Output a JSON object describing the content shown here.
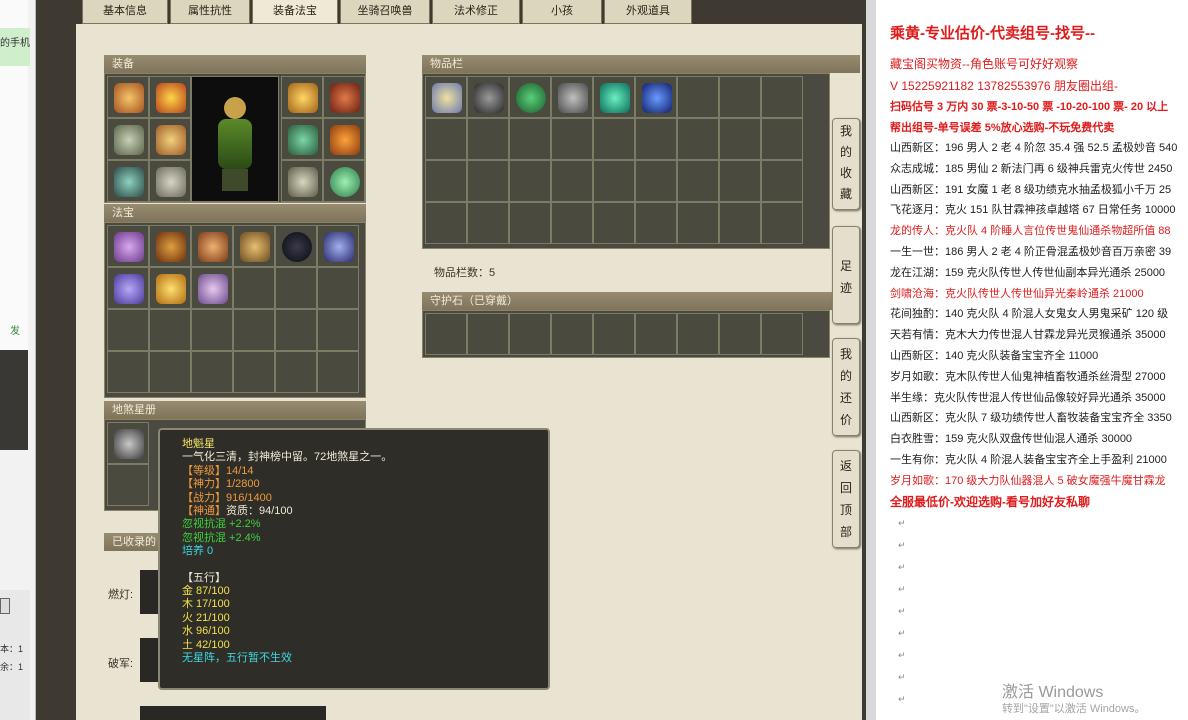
{
  "left_strip": {
    "green_text": "的手机",
    "link_text": "发",
    "bottom_line1": "本：1",
    "bottom_line2": "余：1"
  },
  "tabs": [
    "基本信息",
    "属性抗性",
    "装备法宝",
    "坐骑召唤兽",
    "法术修正",
    "小孩",
    "外观道具"
  ],
  "active_tab": "装备法宝",
  "sections": {
    "equipment": "装备",
    "fabao": "法宝",
    "inventory": "物品栏",
    "guardian": "守护石（已穿戴）",
    "disha": "地煞星册",
    "collected": "已收录的"
  },
  "inventory_count": "物品栏数：5",
  "names": [
    "燃灯:",
    "破军:"
  ],
  "side_buttons": [
    "我的收藏",
    "足迹",
    "我的还价",
    "返回顶部"
  ],
  "tooltip": {
    "title": "地魁星",
    "desc": "一气化三清，封神榜中留。72地煞星之一。",
    "level": "【等级】14/14",
    "shen": "【神力】1/2800",
    "zhan": "【战力】916/1400",
    "shentong_label": "【神通】",
    "shentong_value": "资质：94/100",
    "buff1": "忽视抗混 +2.2%",
    "buff2": "忽视抗混 +2.4%",
    "peiyang": "培养 0",
    "wuxing_title": "【五行】",
    "jin": "金 87/100",
    "mu": "木 17/100",
    "huo": "火 21/100",
    "shui": "水 96/100",
    "tu": "土 42/100",
    "note": "无星阵，五行暂不生效"
  },
  "doc": {
    "title": "乘黄-专业估价-代卖组号-找号--",
    "line1": "藏宝阁买物资--角色账号可好好观察",
    "line2": "V 15225921182   13782553976 朋友圈出组-",
    "line3": "扫码估号 3 万内 30 票-3-10-50 票  -10-20-100 票- 20 以上",
    "line4": "帮出组号-单号误差 5%放心选购-不玩免费代卖",
    "entries": [
      {
        "text": "山西新区：196 男人 2 老 4 阶忽 35.4 强 52.5 孟极妙音 540",
        "red": false
      },
      {
        "text": "众志成城：185 男仙 2 新法门再 6 级神兵雷克火传世 2450",
        "red": false
      },
      {
        "text": "山西新区：191 女魔 1 老 8 级功绩克水抽孟极狐小千万 25",
        "red": false
      },
      {
        "text": "飞花逐月：克火 151 队甘霖神孩卓越塔 67 日常任务 10000",
        "red": false
      },
      {
        "text": "龙的传人：克火队 4 阶睡人言位传世鬼仙通杀物超所值 88",
        "red": true
      },
      {
        "text": "一生一世：186 男人 2 老 4 阶正骨混孟极妙音百万亲密 39",
        "red": false
      },
      {
        "text": "龙在江湖：159 克火队传世人传世仙副本异光通杀 25000",
        "red": false
      },
      {
        "text": "剑啸沧海：克火队传世人传世仙异光秦岭通杀 21000",
        "red": true
      },
      {
        "text": "花间独酌：140 克火队 4 阶混人女鬼女人男鬼采矿 120 级",
        "red": false
      },
      {
        "text": "天若有情：克木大力传世混人甘霖龙异光灵猴通杀 35000",
        "red": false
      },
      {
        "text": "山西新区：140 克火队装备宝宝齐全 11000",
        "red": false
      },
      {
        "text": "岁月如歌：克木队传世人仙鬼神植畜牧通杀丝滑型 27000",
        "red": false
      },
      {
        "text": "半生缘：克火队传世混人传世仙品像较好异光通杀 35000",
        "red": false
      },
      {
        "text": "山西新区：克火队 7 级功绩传世人畜牧装备宝宝齐全 3350",
        "red": false
      },
      {
        "text": "白衣胜雪：159 克火队双盘传世仙混人通杀 30000",
        "red": false
      },
      {
        "text": "一生有你：克火队 4 阶混人装备宝宝齐全上手盈利 21000",
        "red": false
      },
      {
        "text": "岁月如歌：170 级大力队仙器混人 5 破女魔强牛魔甘霖龙",
        "red": true
      },
      {
        "text": "全服最低价-欢迎选购-看号加好友私聊",
        "red": true
      }
    ],
    "watermark": "激活 Windows",
    "watermark_sub": "转到\"设置\"以激活 Windows。"
  },
  "colors": {
    "panel_bg": "#e9e4d2",
    "grid_bg": "#4b4a40",
    "tooltip_bg": "#2e2d28",
    "doc_red": "#e01b1b"
  },
  "icons": {
    "equipment": [
      "hat-icon",
      "crown-icon",
      "ring-icon",
      "armor-icon",
      "necklace-icon",
      "boots-icon",
      "helmet-icon",
      "wing-icon",
      "belt-icon",
      "gem-icon",
      "orb-icon",
      "claw-icon"
    ],
    "fabao": [
      "lantern-icon",
      "book-icon",
      "flute-icon",
      "scepter-icon",
      "void-orb-icon",
      "hand-icon",
      "scroll-icon",
      "fan-icon",
      "bell-icon"
    ],
    "inventory": [
      "fan-icon",
      "helmet-icon",
      "wreath-icon",
      "hammer-icon",
      "jade-icon",
      "crystal-icon"
    ]
  }
}
